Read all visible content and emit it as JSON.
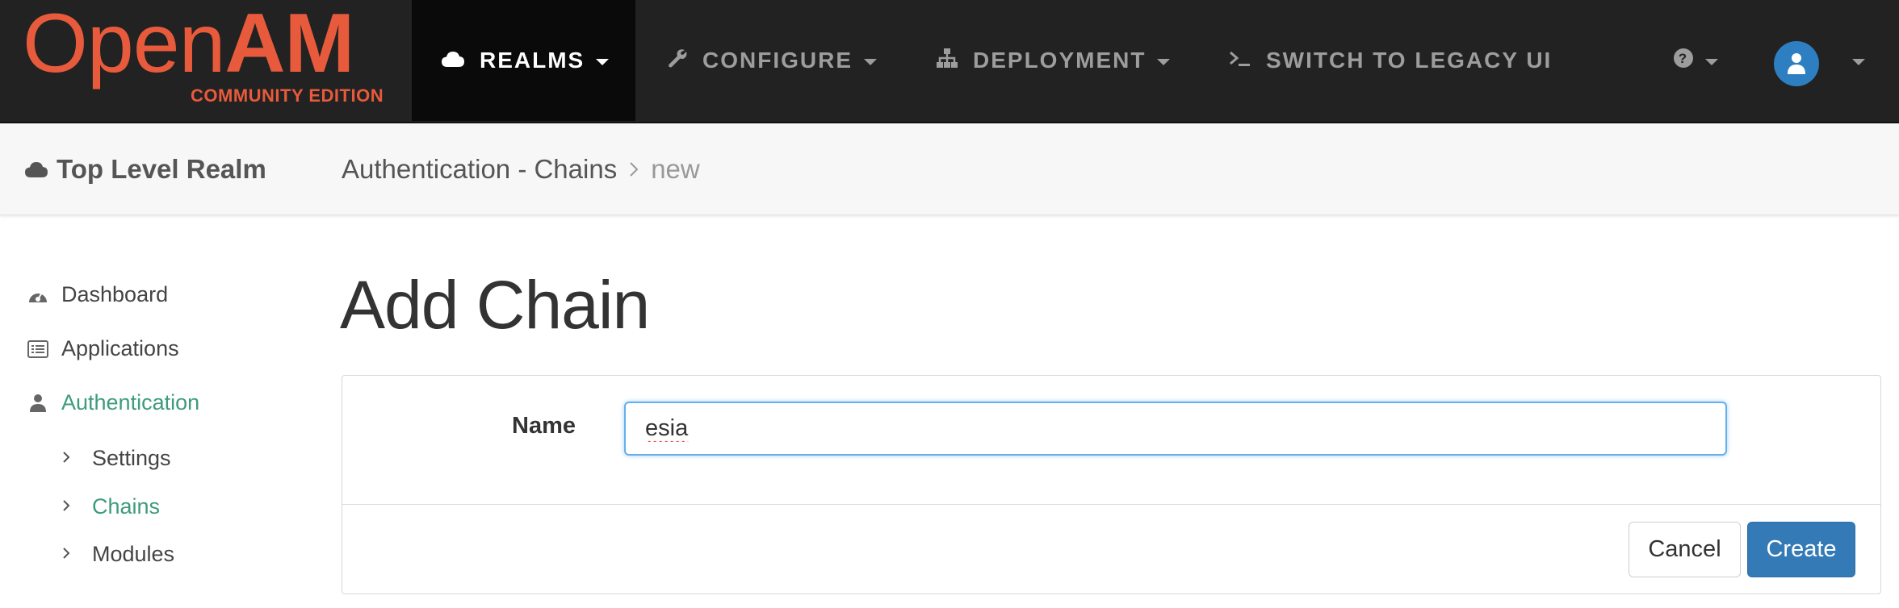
{
  "brand": {
    "logo_open": "Open",
    "logo_am": "AM",
    "edition": "COMMUNITY EDITION",
    "color": "#e85a3c"
  },
  "navbar": {
    "items": [
      {
        "label": "REALMS",
        "icon": "cloud-icon",
        "active": true
      },
      {
        "label": "CONFIGURE",
        "icon": "wrench-icon",
        "active": false
      },
      {
        "label": "DEPLOYMENT",
        "icon": "sitemap-icon",
        "active": false
      },
      {
        "label": "SWITCH TO LEGACY UI",
        "icon": "terminal-icon",
        "active": false
      }
    ],
    "help_icon": "question-circle-icon",
    "user_icon": "user-icon"
  },
  "subbar": {
    "realm": "Top Level Realm",
    "breadcrumb": [
      "Authentication - Chains",
      "new"
    ]
  },
  "sidebar": {
    "items": [
      {
        "label": "Dashboard",
        "icon": "dashboard-icon"
      },
      {
        "label": "Applications",
        "icon": "list-icon"
      },
      {
        "label": "Authentication",
        "icon": "user-icon",
        "active": true
      }
    ],
    "sub_items": [
      {
        "label": "Settings"
      },
      {
        "label": "Chains",
        "active": true
      },
      {
        "label": "Modules"
      }
    ]
  },
  "main": {
    "title": "Add Chain",
    "form": {
      "name_label": "Name",
      "name_value": "esia"
    },
    "buttons": {
      "cancel": "Cancel",
      "create": "Create"
    }
  },
  "colors": {
    "accent_green": "#3e9b7c",
    "primary_blue": "#337ab7",
    "navbar_bg": "#222222"
  }
}
